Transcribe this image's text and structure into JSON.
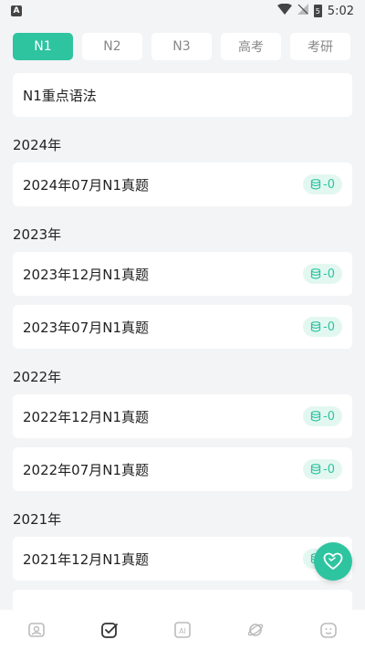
{
  "status_bar": {
    "time": "5:02",
    "app_badge": "A",
    "battery_badge": "5"
  },
  "tabs": [
    {
      "label": "N1",
      "active": true
    },
    {
      "label": "N2",
      "active": false
    },
    {
      "label": "N3",
      "active": false
    },
    {
      "label": "高考",
      "active": false
    },
    {
      "label": "考研",
      "active": false
    }
  ],
  "grammar_card": {
    "label": "N1重点语法"
  },
  "sections": [
    {
      "year": "2024年",
      "items": [
        {
          "title": "2024年07月N1真题",
          "count": "-0"
        }
      ]
    },
    {
      "year": "2023年",
      "items": [
        {
          "title": "2023年12月N1真题",
          "count": "-0"
        },
        {
          "title": "2023年07月N1真题",
          "count": "-0"
        }
      ]
    },
    {
      "year": "2022年",
      "items": [
        {
          "title": "2022年12月N1真题",
          "count": "-0"
        },
        {
          "title": "2022年07月N1真题",
          "count": "-0"
        }
      ]
    },
    {
      "year": "2021年",
      "items": [
        {
          "title": "2021年12月N1真题",
          "count": "-0"
        }
      ]
    }
  ],
  "fab": {
    "icon": "heart-icon"
  },
  "bottom_nav": [
    {
      "icon": "image-icon",
      "active": false
    },
    {
      "icon": "check-note-icon",
      "active": true
    },
    {
      "icon": "ai-icon",
      "active": false
    },
    {
      "icon": "planet-icon",
      "active": false
    },
    {
      "icon": "face-icon",
      "active": false
    }
  ],
  "colors": {
    "accent": "#2ec4a0",
    "badge_bg": "#e3f7f1",
    "page_bg": "#f3f4f6"
  }
}
